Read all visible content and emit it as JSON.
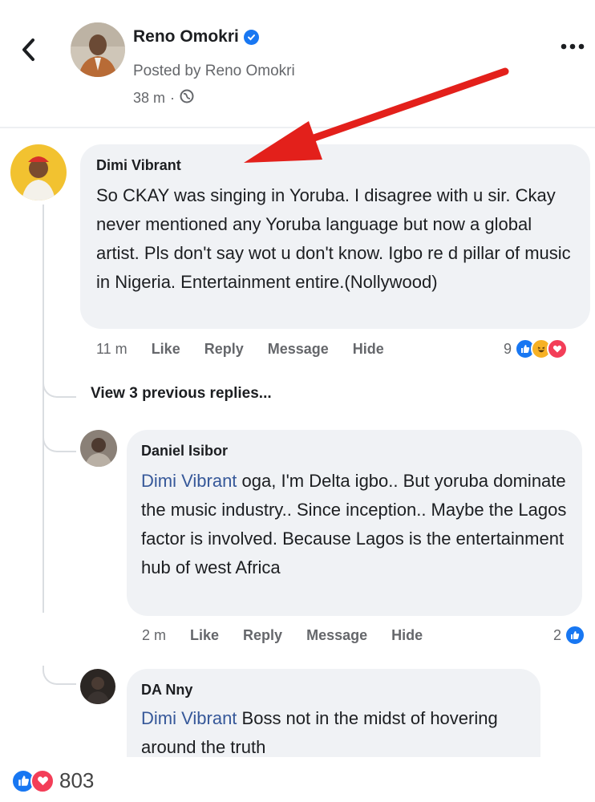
{
  "post": {
    "author": "Reno Omokri",
    "posted_by": "Posted by Reno Omokri",
    "time": "38 m",
    "time_sep": "·"
  },
  "comments": [
    {
      "name": "Dimi Vibrant",
      "text": "So CKAY was singing in Yoruba. I disagree with u sir. Ckay never mentioned any Yoruba language but now a global artist. Pls don't say wot u don't know. Igbo re d pillar of music in Nigeria. Entertainment entire.(Nollywood)",
      "time": "11 m",
      "like": "Like",
      "reply": "Reply",
      "message": "Message",
      "hide": "Hide",
      "reaction_count": "9"
    }
  ],
  "view_previous": "View 3 previous replies...",
  "replies": [
    {
      "name": "Daniel Isibor",
      "mention": "Dimi Vibrant",
      "text": " oga, I'm Delta igbo.. But yoruba dominate the music industry.. Since inception.. Maybe the Lagos factor is involved. Because Lagos is the entertainment hub of west Africa",
      "time": "2 m",
      "like": "Like",
      "reply": "Reply",
      "message": "Message",
      "hide": "Hide",
      "reaction_count": "2"
    },
    {
      "name": "DA Nny",
      "mention": "Dimi Vibrant",
      "text": " Boss not in the midst of hovering around the truth"
    }
  ],
  "footer": {
    "reaction_total": "803"
  },
  "colors": {
    "facebook_blue": "#1877f2",
    "love_red": "#f33e58",
    "arrow_red": "#e3201b",
    "bubble_bg": "#f0f2f5",
    "mention_blue": "#365899"
  },
  "icons": [
    "back-arrow-icon",
    "verified-badge-icon",
    "globe-icon",
    "more-icon",
    "like-reaction-icon",
    "haha-reaction-icon",
    "love-reaction-icon"
  ]
}
